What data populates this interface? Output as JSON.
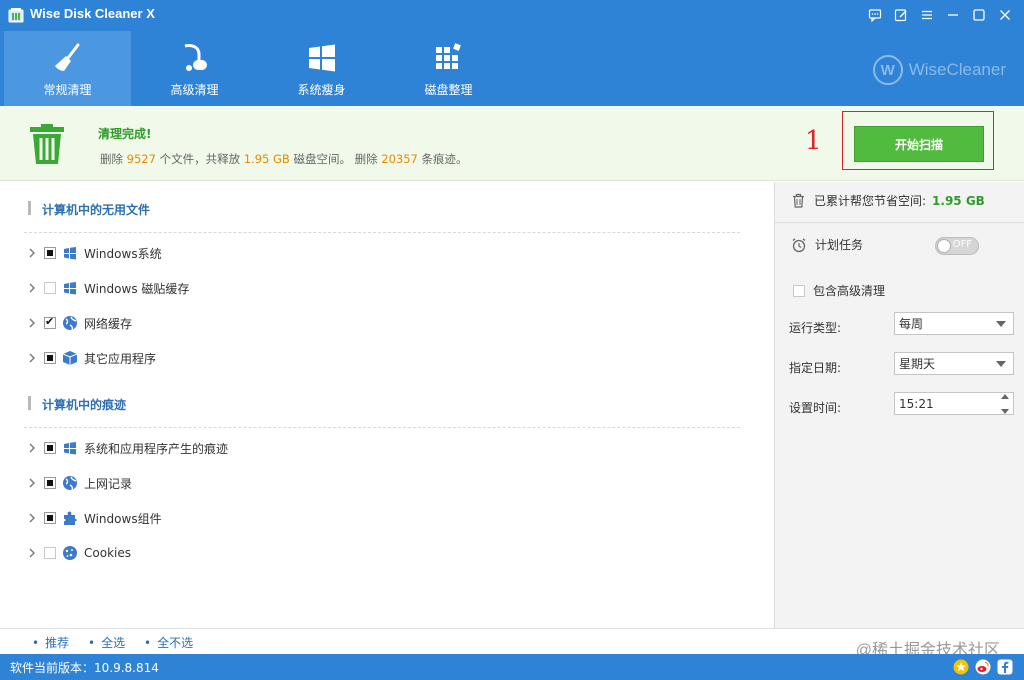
{
  "app": {
    "title": "Wise Disk Cleaner X"
  },
  "tabs": [
    {
      "label": "常规清理",
      "icon": "broom-icon",
      "active": true
    },
    {
      "label": "高级清理",
      "icon": "vacuum-icon",
      "active": false
    },
    {
      "label": "系统瘦身",
      "icon": "windows-logo-icon",
      "active": false
    },
    {
      "label": "磁盘整理",
      "icon": "defrag-blocks-icon",
      "active": false
    }
  ],
  "brand": {
    "logo_letter": "W",
    "name": "WiseCleaner"
  },
  "banner": {
    "title": "清理完成!",
    "detail_prefix": "删除",
    "files_count": "9527",
    "files_unit": "个文件，共释放",
    "freed": "1.95 GB",
    "freed_suffix": "磁盘空间。 删除",
    "traces_count": "20357",
    "traces_suffix": "条痕迹。"
  },
  "annotation": {
    "mark": "1"
  },
  "scan_button": {
    "label": "开始扫描"
  },
  "sections": [
    {
      "title": "计算机中的无用文件",
      "items": [
        {
          "label": "Windows系统",
          "state": "partial",
          "icon": "windows-flag-icon"
        },
        {
          "label": "Windows 磁贴缓存",
          "state": "empty",
          "icon": "windows-flag-icon"
        },
        {
          "label": "网络缓存",
          "state": "checked",
          "icon": "globe-icon"
        },
        {
          "label": "其它应用程序",
          "state": "partial",
          "icon": "box-icon"
        }
      ]
    },
    {
      "title": "计算机中的痕迹",
      "items": [
        {
          "label": "系统和应用程序产生的痕迹",
          "state": "partial",
          "icon": "windows-flag-icon"
        },
        {
          "label": "上网记录",
          "state": "partial",
          "icon": "globe-icon"
        },
        {
          "label": "Windows组件",
          "state": "partial",
          "icon": "puzzle-icon"
        },
        {
          "label": "Cookies",
          "state": "empty",
          "icon": "cookie-icon"
        }
      ]
    }
  ],
  "side": {
    "saved_label": "已累计帮您节省空间:",
    "saved_value": "1.95 GB",
    "schedule_label": "计划任务",
    "toggle_text": "OFF",
    "advanced_label": "包含高级清理",
    "run_type_label": "运行类型:",
    "run_type_value": "每周",
    "date_label": "指定日期:",
    "date_value": "星期天",
    "time_label": "设置时间:",
    "time_value": "15:21"
  },
  "links": {
    "recommend": "推荐",
    "select_all": "全选",
    "select_none": "全不选"
  },
  "watermark": "@稀土掘金技术社区",
  "status": {
    "version": "软件当前版本：10.9.8.814"
  },
  "colors": {
    "primary": "#2f83d6",
    "success": "#51bb3f",
    "highlight": "#e68a00",
    "annotation": "#d9262b"
  }
}
